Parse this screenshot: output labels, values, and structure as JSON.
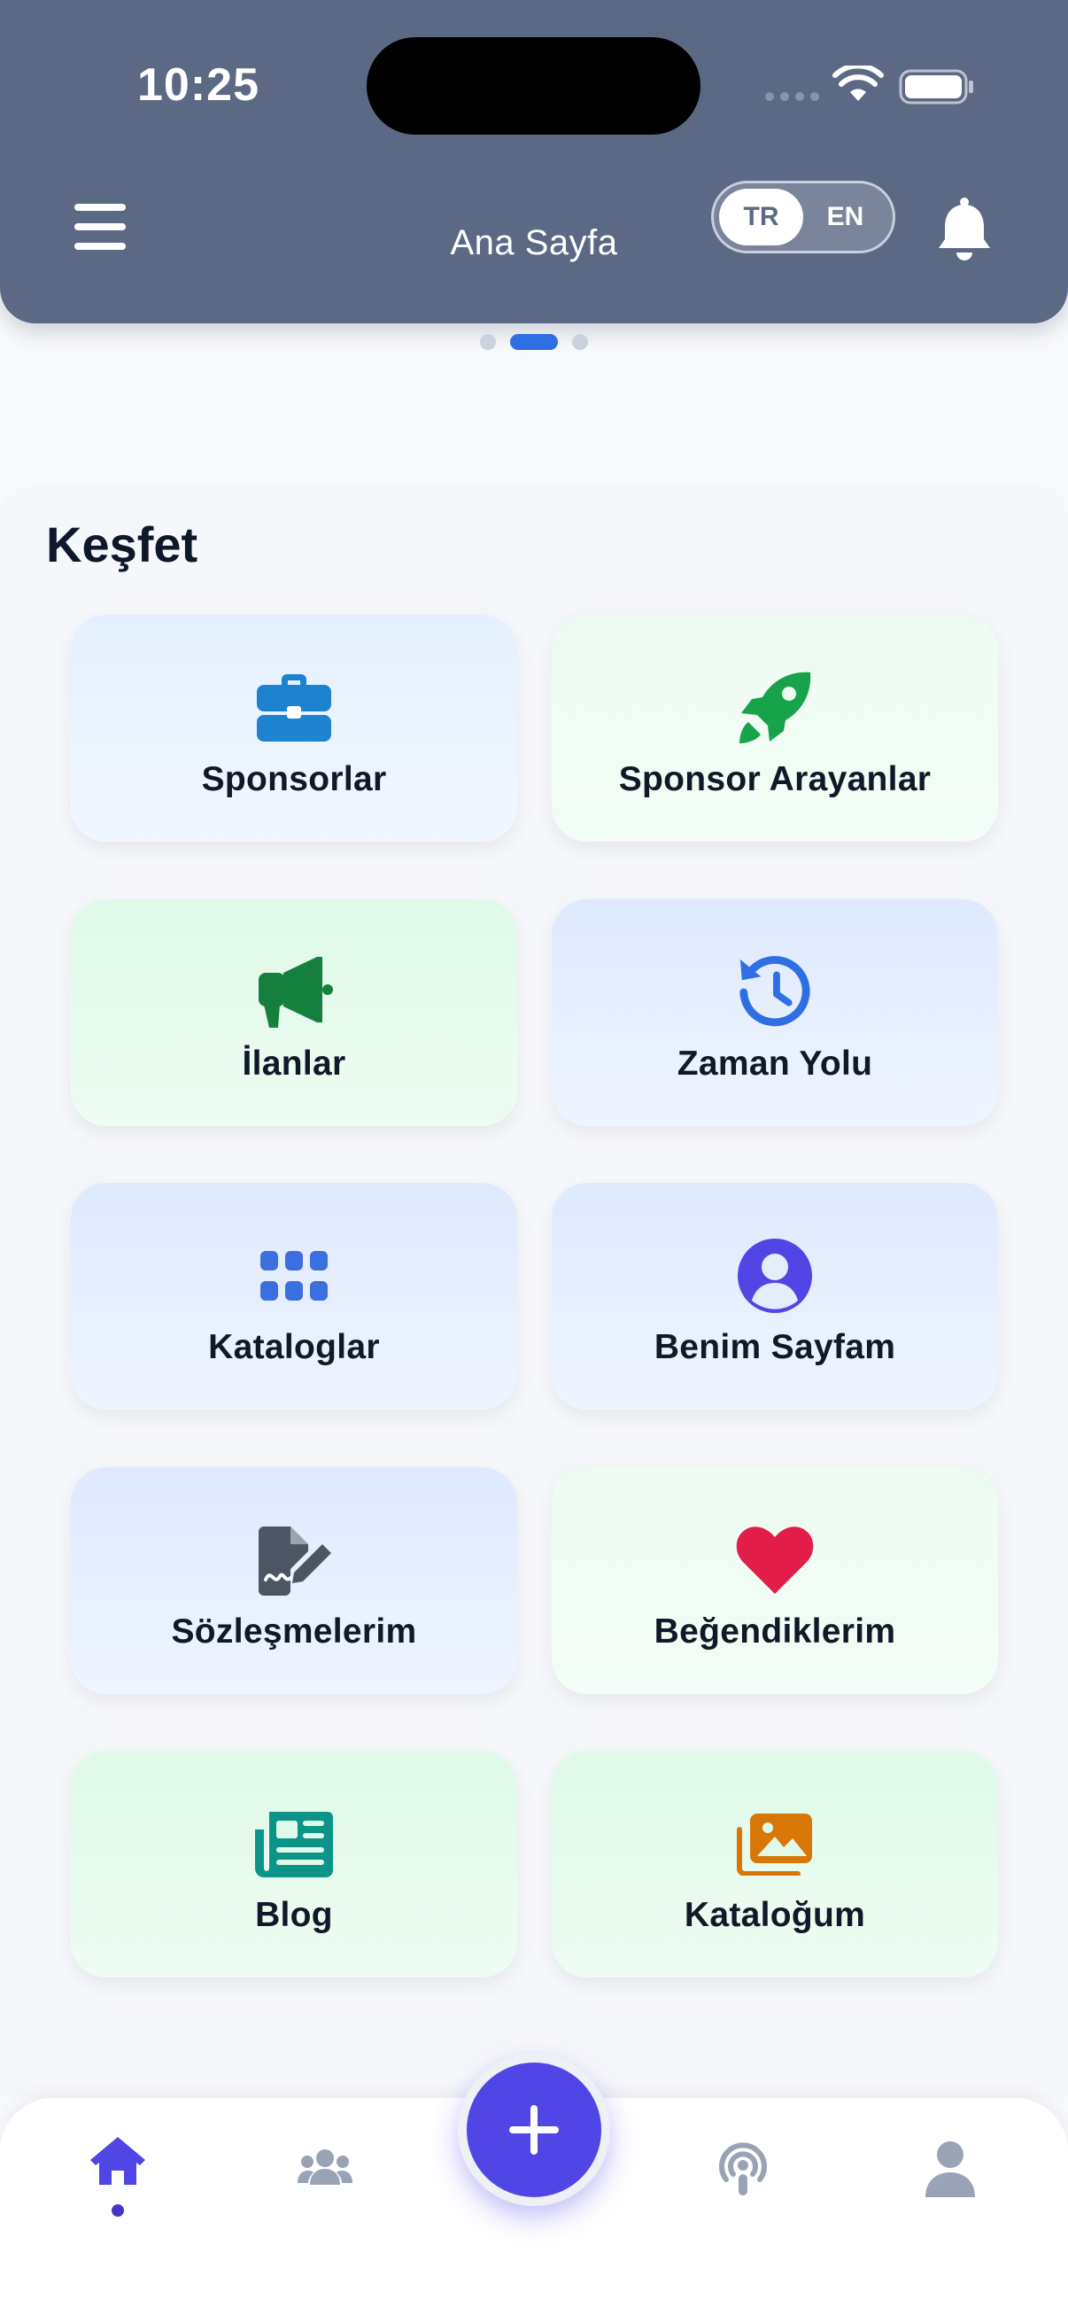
{
  "status_bar": {
    "time": "10:25"
  },
  "header": {
    "title": "Ana Sayfa",
    "language": {
      "options": [
        "TR",
        "EN"
      ],
      "selected": "TR"
    }
  },
  "pager": {
    "pages": 3,
    "active_index": 1
  },
  "section": {
    "title": "Keşfet",
    "cards": [
      {
        "label": "Sponsorlar",
        "icon": "briefcase-icon",
        "color": "#1d83d1"
      },
      {
        "label": "Sponsor Arayanlar",
        "icon": "rocket-icon",
        "color": "#16a34a"
      },
      {
        "label": "İlanlar",
        "icon": "megaphone-icon",
        "color": "#15803d"
      },
      {
        "label": "Zaman Yolu",
        "icon": "history-icon",
        "color": "#2f6fe4"
      },
      {
        "label": "Kataloglar",
        "icon": "grid-icon",
        "color": "#3b6fe0"
      },
      {
        "label": "Benim Sayfam",
        "icon": "user-circle-icon",
        "color": "#4f46e5"
      },
      {
        "label": "Sözleşmelerim",
        "icon": "contract-signature-icon",
        "color": "#4b5563"
      },
      {
        "label": "Beğendiklerim",
        "icon": "heart-icon",
        "color": "#e11d48"
      },
      {
        "label": "Blog",
        "icon": "newspaper-icon",
        "color": "#0d9488"
      },
      {
        "label": "Kataloğum",
        "icon": "images-icon",
        "color": "#d97706"
      }
    ]
  },
  "bottom_nav": {
    "items": [
      "home-icon",
      "users-icon",
      "add-icon",
      "podcast-icon",
      "profile-icon"
    ],
    "active": "home-icon",
    "accent": "#4f46e5"
  }
}
